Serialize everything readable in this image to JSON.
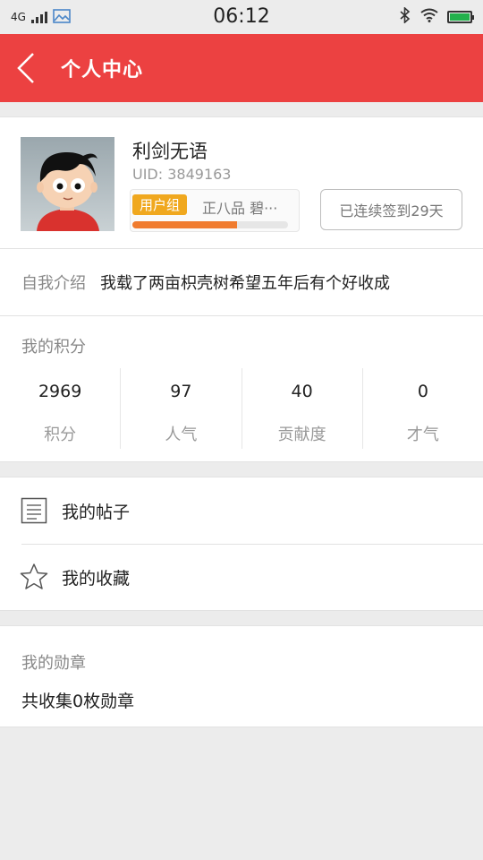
{
  "status_bar": {
    "network": "4G",
    "time": "06:12",
    "icons": [
      "signal-icon",
      "image-icon",
      "bluetooth-icon",
      "wifi-icon",
      "battery-icon"
    ]
  },
  "header": {
    "title": "个人中心",
    "back_icon": "chevron-left-icon",
    "color": "#ec4141"
  },
  "profile": {
    "username": "利剑无语",
    "uid": "UID: 3849163",
    "group_tag": "用户组",
    "group_rank": "正八品  碧···",
    "group_progress": 0.67,
    "signin_button": "已连续签到29天"
  },
  "intro": {
    "label": "自我介绍",
    "value": "我载了两亩枳壳树希望五年后有个好收成"
  },
  "points": {
    "label": "我的积分",
    "items": [
      {
        "value": "2969",
        "caption": "积分"
      },
      {
        "value": "97",
        "caption": "人气"
      },
      {
        "value": "40",
        "caption": "贡献度"
      },
      {
        "value": "0",
        "caption": "才气"
      }
    ]
  },
  "menu": {
    "items": [
      {
        "label": "我的帖子",
        "icon": "document-icon"
      },
      {
        "label": "我的收藏",
        "icon": "star-icon"
      }
    ]
  },
  "medals": {
    "label": "我的勋章",
    "value": "共收集0枚勋章"
  }
}
